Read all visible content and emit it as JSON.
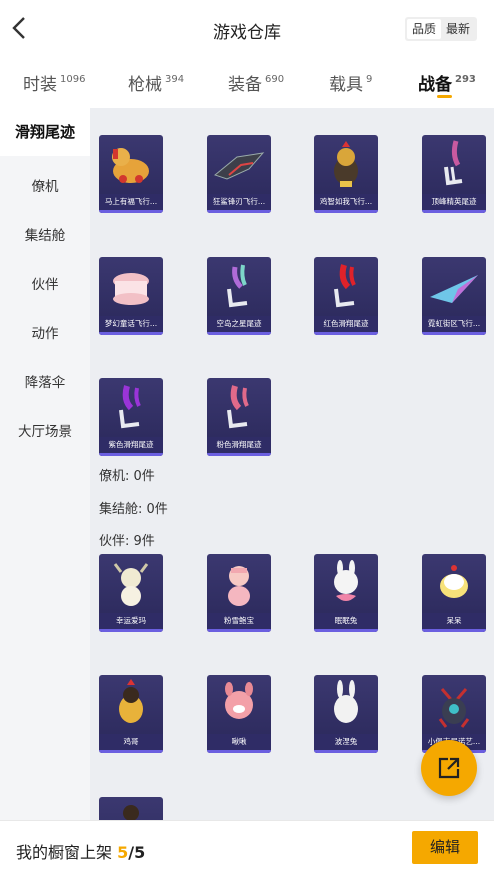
{
  "header": {
    "title": "游戏仓库",
    "sort_quality": "品质",
    "sort_latest": "最新"
  },
  "tabs": [
    {
      "label": "时装",
      "count": "1096"
    },
    {
      "label": "枪械",
      "count": "394"
    },
    {
      "label": "装备",
      "count": "690"
    },
    {
      "label": "载具",
      "count": "9"
    },
    {
      "label": "战备",
      "count": "293"
    }
  ],
  "sidenav": [
    "滑翔尾迹",
    "僚机",
    "集结舱",
    "伙伴",
    "动作",
    "降落伞",
    "大厅场景"
  ],
  "trails": [
    "马上有福飞行...",
    "狂鲨锋刃飞行...",
    "鸡智如我飞行...",
    "顶峰精英尾迹",
    "梦幻童话飞行...",
    "空岛之星尾迹",
    "红色滑翔尾迹",
    "霓虹街区飞行...",
    "紫色滑翔尾迹",
    "粉色滑翔尾迹"
  ],
  "sections": {
    "wingman": "僚机: 0件",
    "capsule": "集结舱: 0件",
    "partner": "伙伴: 9件"
  },
  "partners": [
    "幸运爱玛",
    "粉雪鲍宝",
    "眠眠兔",
    "呆呆",
    "鸡哥",
    "啾啾",
    "波涅兔",
    "小佩吉尼诺艺..."
  ],
  "bottom": {
    "shelf_label": "我的橱窗上架",
    "shelf_current": "5",
    "shelf_total": "/5",
    "edit_label": "编辑"
  },
  "colors": {
    "accent": "#f5a800",
    "card_bg": "#2f2c66",
    "card_border": "#6b5fe0"
  }
}
